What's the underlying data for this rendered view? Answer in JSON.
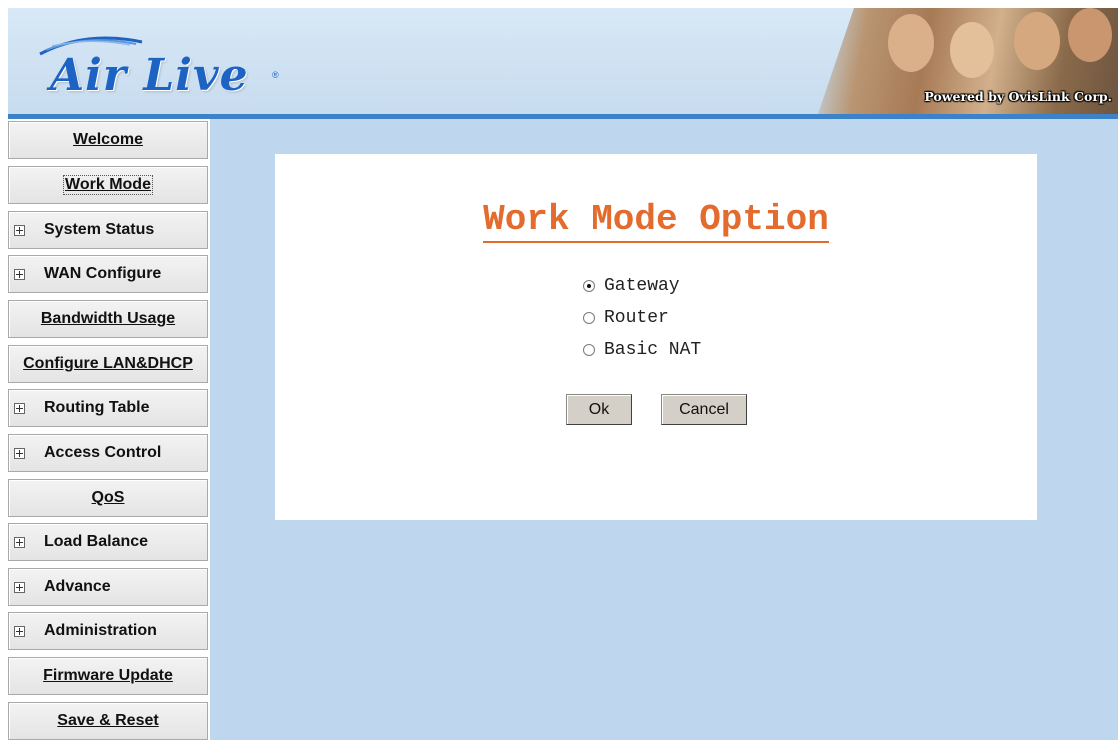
{
  "brand": {
    "logo_text": "Air Live",
    "registered": "®",
    "powered_by": "Powered by OvisLink Corp."
  },
  "sidebar": {
    "items": [
      {
        "label": "Welcome",
        "type": "link",
        "active": false
      },
      {
        "label": "Work Mode",
        "type": "link",
        "active": true
      },
      {
        "label": "System Status",
        "type": "expand"
      },
      {
        "label": "WAN Configure",
        "type": "expand"
      },
      {
        "label": "Bandwidth Usage",
        "type": "link"
      },
      {
        "label": "Configure LAN&DHCP",
        "type": "link"
      },
      {
        "label": "Routing Table",
        "type": "expand"
      },
      {
        "label": "Access Control",
        "type": "expand"
      },
      {
        "label": "QoS",
        "type": "link"
      },
      {
        "label": "Load Balance",
        "type": "expand"
      },
      {
        "label": "Advance",
        "type": "expand"
      },
      {
        "label": "Administration",
        "type": "expand"
      },
      {
        "label": "Firmware Update",
        "type": "link"
      },
      {
        "label": "Save & Reset",
        "type": "link"
      }
    ]
  },
  "main": {
    "title": "Work Mode Option",
    "options": [
      {
        "label": "Gateway",
        "checked": true
      },
      {
        "label": "Router",
        "checked": false
      },
      {
        "label": "Basic NAT",
        "checked": false
      }
    ],
    "ok_label": "Ok",
    "cancel_label": "Cancel"
  },
  "colors": {
    "header_bg": "#c7dcef",
    "header_line": "#3b82c8",
    "main_bg": "#bed7ee",
    "title": "#e36b2d",
    "logo": "#1d63c4"
  }
}
